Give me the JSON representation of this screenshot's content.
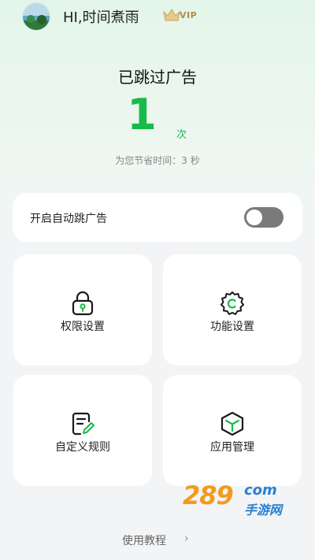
{
  "header": {
    "username": "HI,时间煮雨",
    "vip_label": "VIP"
  },
  "stats": {
    "title": "已跳过广告",
    "count": "1",
    "unit": "次",
    "saved_time": "为您节省时间：3 秒"
  },
  "auto_skip": {
    "label": "开启自动跳广告",
    "enabled": false
  },
  "cards": {
    "permission": {
      "label": "权限设置",
      "icon": "lock-icon"
    },
    "function": {
      "label": "功能设置",
      "icon": "gear-icon"
    },
    "custom_rules": {
      "label": "自定义规则",
      "icon": "edit-document-icon"
    },
    "app_management": {
      "label": "应用管理",
      "icon": "cube-icon"
    }
  },
  "footer": {
    "tutorial_label": "使用教程",
    "arrow": "›"
  },
  "watermark": {
    "number": "289",
    "com": "com",
    "site": "手游网"
  },
  "colors": {
    "accent": "#17bb4a",
    "switch_off": "#7a7a7a",
    "icon_dark": "#1a1a1a"
  }
}
